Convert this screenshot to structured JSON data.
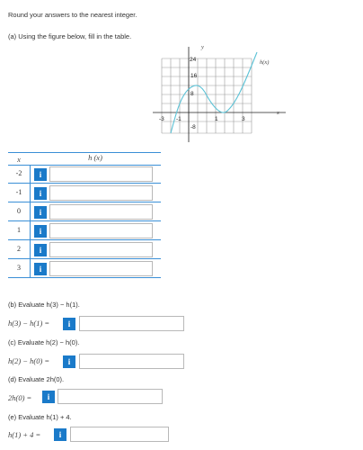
{
  "instructions": "Round your answers to the nearest integer.",
  "part_a": {
    "prompt": "(a) Using the figure below, fill in the table.",
    "graph": {
      "y_label": "y",
      "x_label": "x",
      "curve_label": "h(x)",
      "y_ticks": [
        "24",
        "16",
        "8",
        "-8"
      ],
      "x_ticks": [
        "-3",
        "-1",
        "1",
        "3"
      ]
    },
    "table": {
      "col_x": "x",
      "col_h": "h (x)",
      "rows": [
        {
          "x": "-2",
          "value": ""
        },
        {
          "x": "-1",
          "value": ""
        },
        {
          "x": "0",
          "value": ""
        },
        {
          "x": "1",
          "value": ""
        },
        {
          "x": "2",
          "value": ""
        },
        {
          "x": "3",
          "value": ""
        }
      ]
    }
  },
  "part_b": {
    "prompt": "(b) Evaluate h(3) − h(1).",
    "lhs": "h(3) − h(1) =",
    "value": ""
  },
  "part_c": {
    "prompt": "(c) Evaluate h(2) − h(0).",
    "lhs": "h(2) − h(0) =",
    "value": ""
  },
  "part_d": {
    "prompt": "(d) Evaluate 2h(0).",
    "lhs": "2h(0) =",
    "value": ""
  },
  "part_e": {
    "prompt": "(e) Evaluate h(1) + 4.",
    "lhs": "h(1) + 4 =",
    "value": ""
  },
  "info_glyph": "i",
  "colors": {
    "accent": "#1a7ac9",
    "table_line": "#3a8fd6",
    "curve": "#5bc2d6",
    "field_border": "#b8b8b8"
  }
}
